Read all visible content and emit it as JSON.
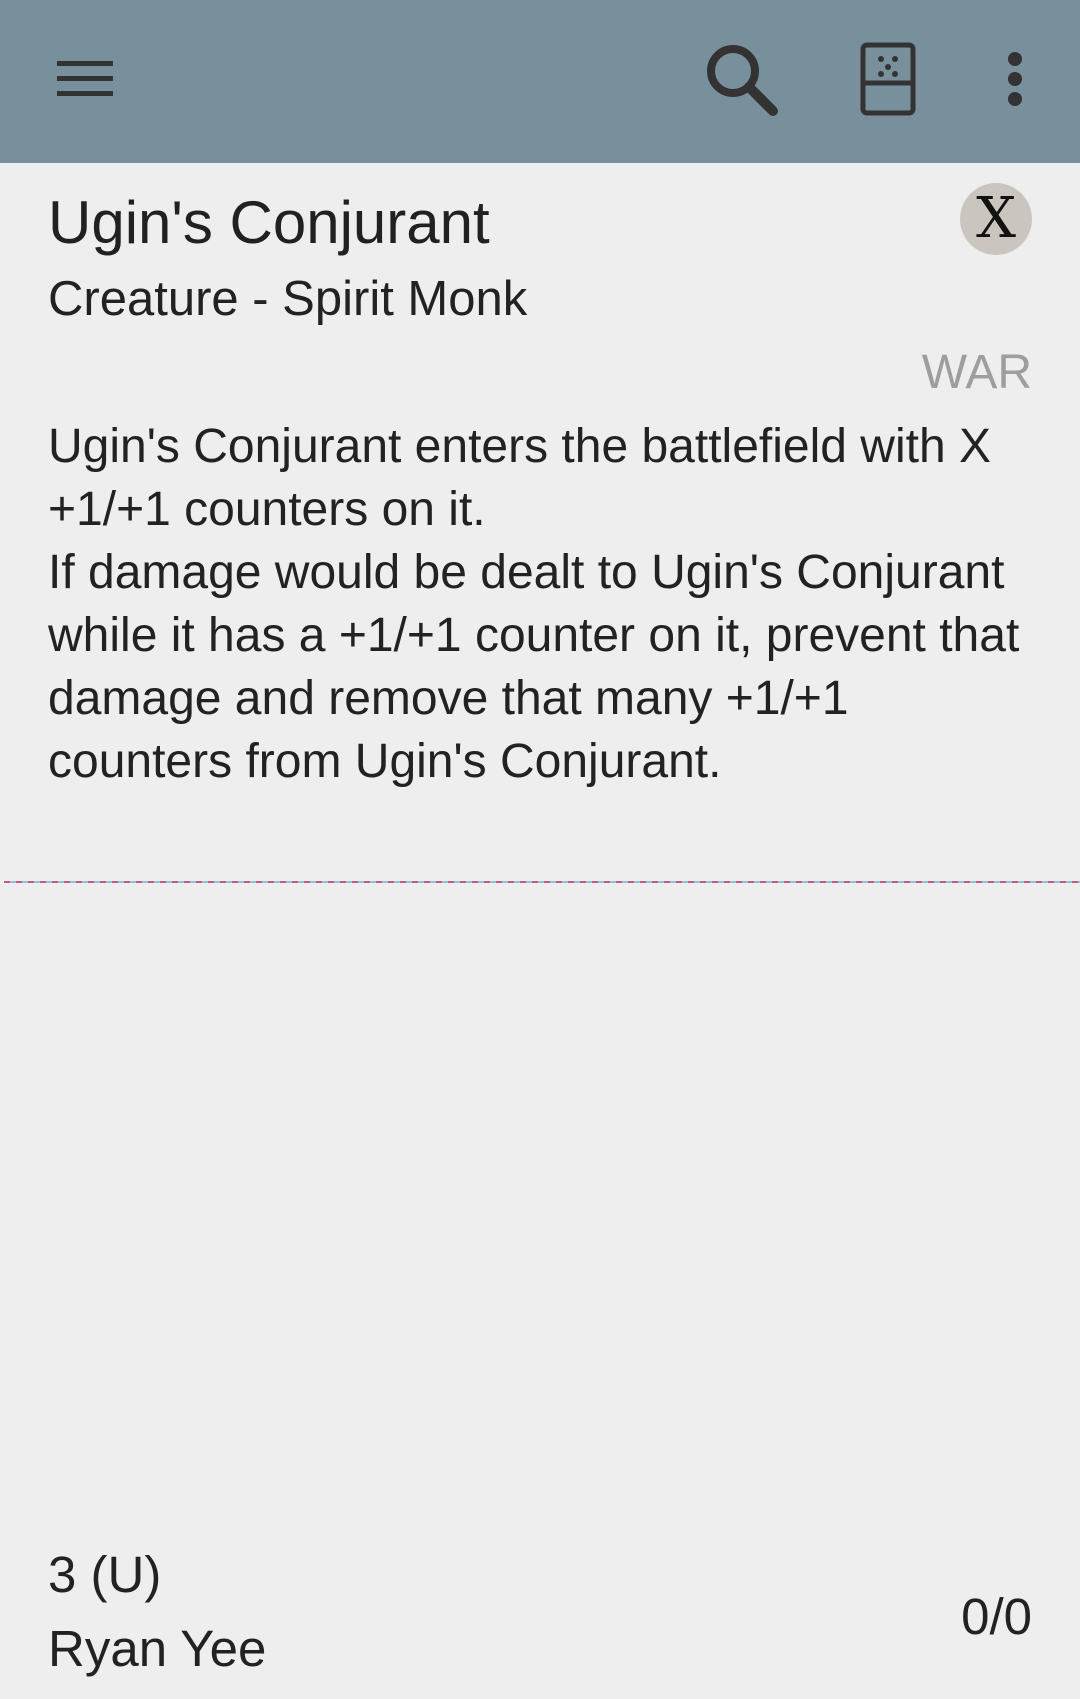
{
  "appbar": {
    "background_color": "#78909c",
    "icons": {
      "menu": "hamburger-menu-icon",
      "search": "search-icon",
      "card": "card-icon",
      "more": "more-vert-icon"
    }
  },
  "card": {
    "name": "Ugin's Conjurant",
    "mana_cost": "X",
    "type_line": "Creature - Spirit Monk",
    "set_code": "WAR",
    "rules_text": "Ugin's Conjurant enters the battlefield with X +1/+1 counters on it.\nIf damage would be dealt to Ugin's Conjurant while it has a +1/+1 counter on it, prevent that damage and remove that many +1/+1 counters from Ugin's Conjurant.",
    "cmc_rarity": "3 (U)",
    "artist": "Ryan Yee",
    "power_toughness": "0/0"
  }
}
